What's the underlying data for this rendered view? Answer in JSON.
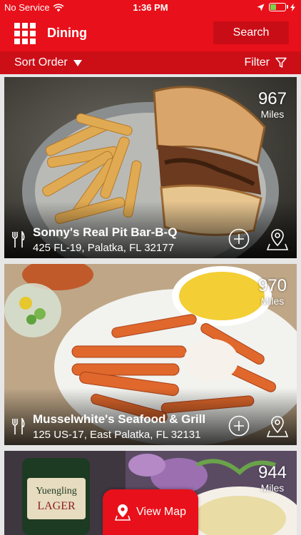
{
  "status_bar": {
    "carrier": "No Service",
    "time": "1:36 PM",
    "battery_level": 0.35
  },
  "nav": {
    "title": "Dining",
    "search_label": "Search"
  },
  "toolbar": {
    "sort_label": "Sort Order",
    "filter_label": "Filter"
  },
  "restaurants": [
    {
      "name": "Sonny's Real Pit Bar-B-Q",
      "address": "425 FL-19, Palatka, FL 32177",
      "distance": "967",
      "distance_unit": "Miles"
    },
    {
      "name": "Musselwhite's Seafood & Grill",
      "address": "125 US-17, East Palatka, FL 32131",
      "distance": "970",
      "distance_unit": "Miles"
    },
    {
      "distance": "944",
      "distance_unit": "Miles"
    }
  ],
  "view_map_label": "View Map",
  "colors": {
    "brand_red": "#e8101a",
    "brand_red_dark": "#cc0e17"
  },
  "icons": [
    "wifi-icon",
    "location-arrow-icon",
    "battery-icon",
    "grid-menu-icon",
    "caret-down-icon",
    "filter-funnel-icon",
    "utensils-icon",
    "add-circle-icon",
    "map-pin-icon"
  ]
}
